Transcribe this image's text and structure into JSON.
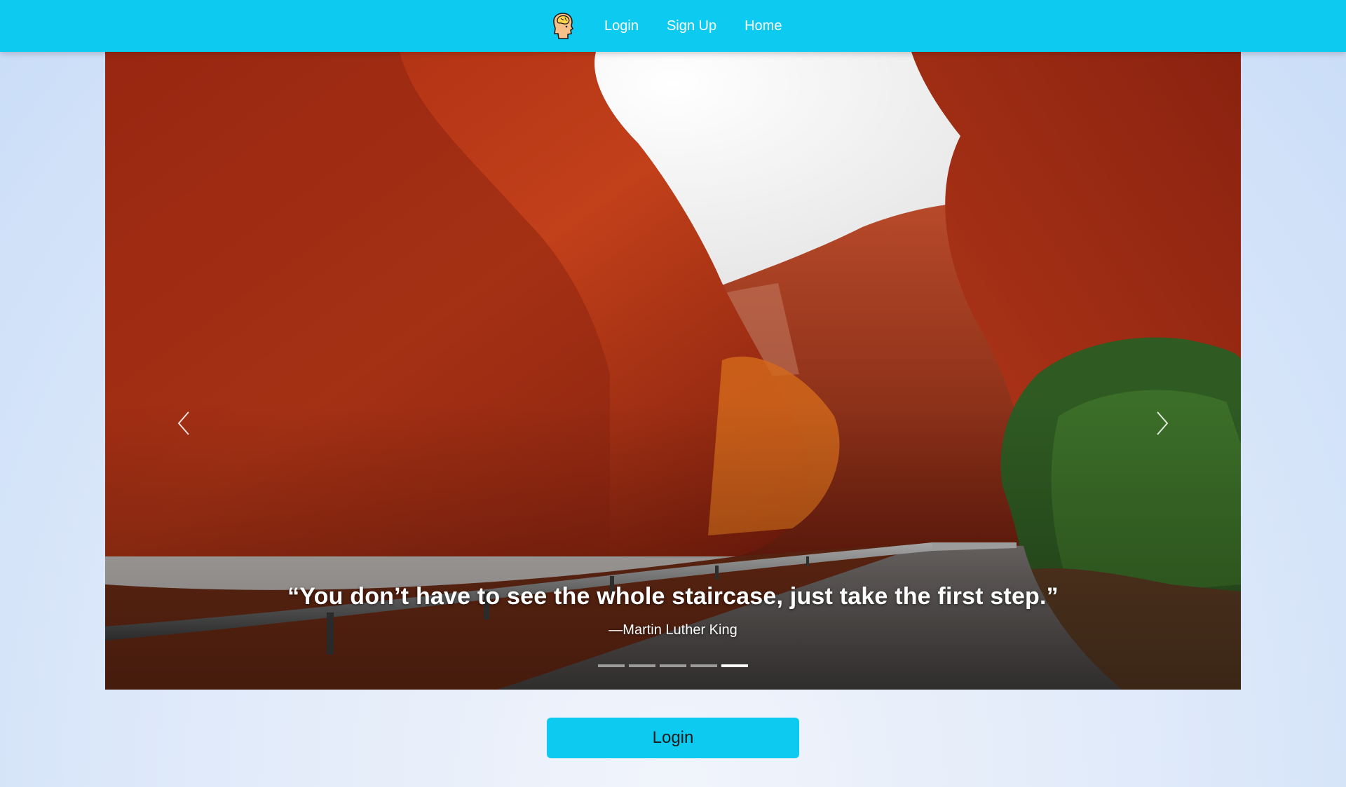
{
  "nav": {
    "logo_icon": "brain-head-icon",
    "links": [
      "Login",
      "Sign Up",
      "Home"
    ]
  },
  "carousel": {
    "quote": "“You don’t have to see the whole staircase, just take the first step.”",
    "author": "—Martin Luther King",
    "slide_count": 5,
    "active_slide": 5,
    "prev_icon": "chevron-left-icon",
    "next_icon": "chevron-right-icon"
  },
  "main": {
    "login_button": "Login"
  },
  "colors": {
    "accent": "#0ccaf0",
    "background": "#e2ebfa"
  }
}
